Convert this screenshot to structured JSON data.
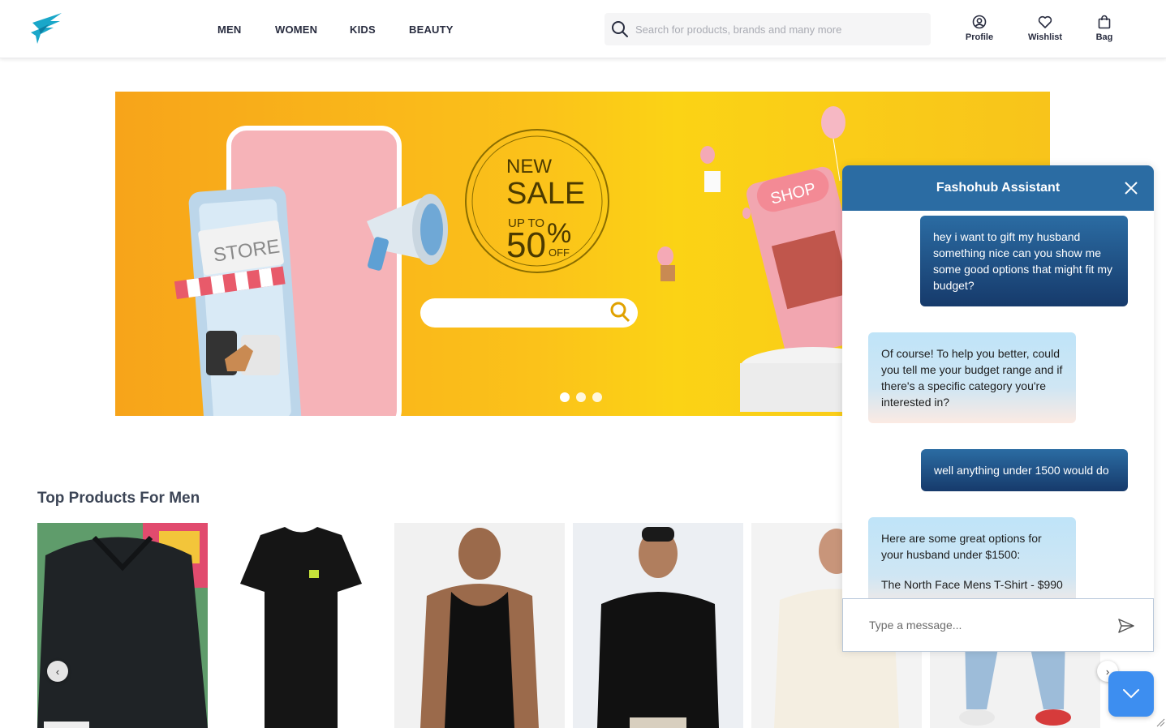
{
  "header": {
    "logo_icon": "bird-logo-icon",
    "nav": [
      "MEN",
      "WOMEN",
      "KIDS",
      "BEAUTY"
    ],
    "search_placeholder": "Search for products, brands and many more",
    "actions": {
      "profile": "Profile",
      "wishlist": "Wishlist",
      "bag": "Bag"
    }
  },
  "banner": {
    "store_sign": "STORE",
    "sale_new": "NEW",
    "sale_word": "SALE",
    "sale_upto": "UP TO",
    "sale_number": "50",
    "sale_percent": "%",
    "sale_off": "OFF",
    "shop_sign": "SHOP",
    "slide_count": 3,
    "active_slide": 1
  },
  "products": {
    "title": "Top Products For Men",
    "prev_icon": "chevron-left-icon",
    "next_icon": "chevron-right-icon"
  },
  "chat": {
    "title": "Fashohub Assistant",
    "messages": [
      {
        "from": "user",
        "text": "hey i want to gift my husband something nice can you show me some good options that might fit my budget?"
      },
      {
        "from": "bot",
        "text": "Of course! To help you better, could you tell me your budget range and if there's a specific category you're interested in?"
      },
      {
        "from": "user",
        "text": "well anything under 1500 would do"
      },
      {
        "from": "bot",
        "text": "Here are some great options for your husband under $1500:",
        "item1": "The North Face Mens T-Shirt - $990"
      }
    ],
    "input_placeholder": "Type a message..."
  },
  "colors": {
    "chat_header": "#2b6ca3",
    "user_bubble": "#163a6b",
    "bot_bubble": "#bfe4f8",
    "fab": "#3d8ef0",
    "banner_yellow": "#fbc21a"
  }
}
